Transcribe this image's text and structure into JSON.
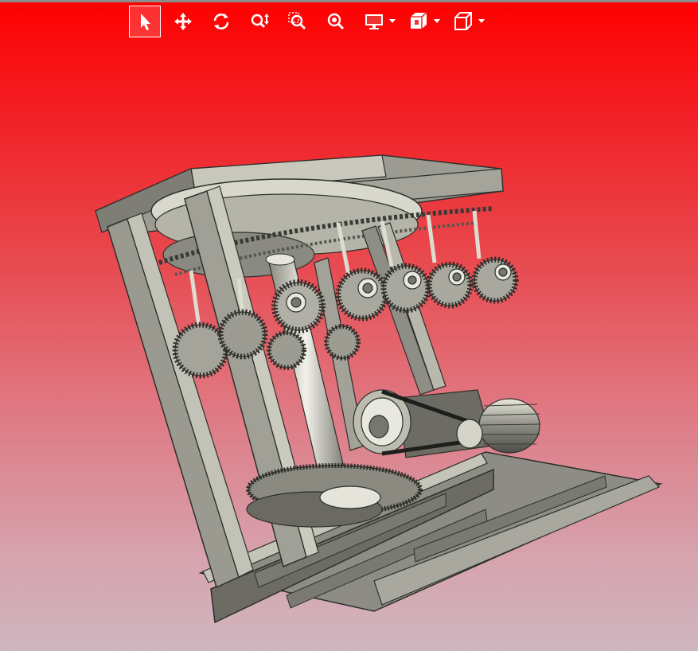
{
  "toolbar": {
    "tools": [
      {
        "id": "select",
        "icon": "arrow-cursor-icon",
        "active": true
      },
      {
        "id": "pan",
        "icon": "move-arrows-icon",
        "active": false
      },
      {
        "id": "rotate",
        "icon": "rotate-icon",
        "active": false
      },
      {
        "id": "zoom",
        "icon": "zoom-updown-icon",
        "active": false
      },
      {
        "id": "zoom-window",
        "icon": "zoom-window-icon",
        "active": false
      },
      {
        "id": "zoom-fit",
        "icon": "zoom-fit-icon",
        "active": false
      },
      {
        "id": "display-mode",
        "icon": "monitor-icon",
        "dropdown": true
      },
      {
        "id": "view-layers",
        "icon": "layers-icon",
        "dropdown": true
      },
      {
        "id": "view-orientation",
        "icon": "cube-icon",
        "dropdown": true
      }
    ]
  },
  "colors": {
    "background_top": "#ff0000",
    "background_bottom": "#cfb6bf",
    "steel": "#8a8a80",
    "steel_light": "#c8c8bc",
    "steel_dark": "#4a4a44",
    "icon": "#ffffff"
  }
}
